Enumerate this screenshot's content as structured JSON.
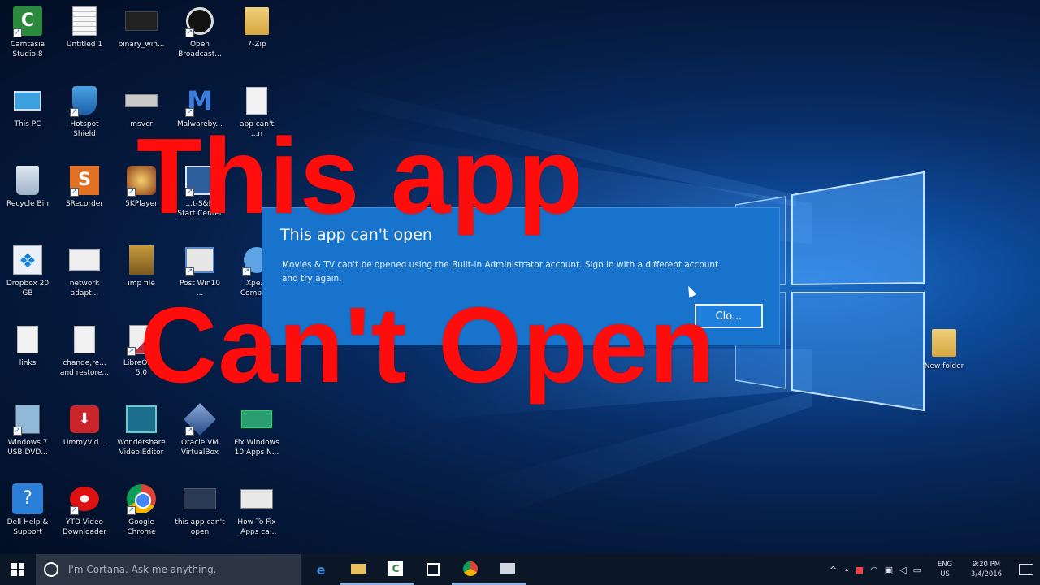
{
  "desktop": {
    "icons": [
      {
        "label": "Camtasia\nStudio 8",
        "icon": "camtasia-icon"
      },
      {
        "label": "Untitled 1",
        "icon": "document-icon"
      },
      {
        "label": "binary_win...",
        "icon": "video-thumbnail-icon"
      },
      {
        "label": "Open\nBroadcast...",
        "icon": "obs-icon"
      },
      {
        "label": "7-Zip",
        "icon": "folder-icon"
      },
      {
        "label": "This PC",
        "icon": "computer-icon"
      },
      {
        "label": "Hotspot\nShield",
        "icon": "shield-icon"
      },
      {
        "label": "msvcr",
        "icon": "file-icon"
      },
      {
        "label": "Malwareby...",
        "icon": "malwarebytes-icon"
      },
      {
        "label": "app can't\n...n",
        "icon": "document-icon"
      },
      {
        "label": "Recycle Bin",
        "icon": "recycle-bin-icon"
      },
      {
        "label": "SRecorder",
        "icon": "recorder-icon"
      },
      {
        "label": "5KPlayer",
        "icon": "player-icon"
      },
      {
        "label": "...t-S&D\nStart Center",
        "icon": "app-icon"
      },
      {
        "label": "Dropbox 20\nGB",
        "icon": "dropbox-icon"
      },
      {
        "label": "network\nadapt...",
        "icon": "network-icon"
      },
      {
        "label": "imp file",
        "icon": "archive-icon"
      },
      {
        "label": "Post Win10\n...",
        "icon": "app-icon"
      },
      {
        "label": "Xpe...\nCompa...",
        "icon": "app-icon"
      },
      {
        "label": "links",
        "icon": "document-icon"
      },
      {
        "label": "change,re...\nand restore...",
        "icon": "document-icon"
      },
      {
        "label": "LibreOff...\n5.0",
        "icon": "libreoffice-icon"
      },
      {
        "label": "Windows 7\nUSB DVD...",
        "icon": "usb-tool-icon"
      },
      {
        "label": "UmmyVid...",
        "icon": "ummy-icon"
      },
      {
        "label": "Wondershare\nVideo Editor",
        "icon": "video-editor-icon"
      },
      {
        "label": "Oracle VM\nVirtualBox",
        "icon": "virtualbox-icon"
      },
      {
        "label": "Fix Windows\n10 Apps N...",
        "icon": "video-thumbnail-icon"
      },
      {
        "label": "Dell Help &\nSupport",
        "icon": "dell-help-icon"
      },
      {
        "label": "YTD Video\nDownloader",
        "icon": "ytd-icon"
      },
      {
        "label": "Google\nChrome",
        "icon": "chrome-icon"
      },
      {
        "label": "this app can't\nopen",
        "icon": "video-thumbnail-icon"
      },
      {
        "label": "How To Fix\n_Apps ca...",
        "icon": "video-thumbnail-icon"
      },
      {
        "label": "New folder",
        "icon": "folder-icon"
      }
    ]
  },
  "dialog": {
    "title": "This app can't open",
    "message": "Movies & TV can't be opened using the Built-in Administrator account. Sign in with a different account and try again.",
    "button_label": "Clo..."
  },
  "overlay": {
    "line1": "This app",
    "line2": "Can't Open",
    "color": "#ff0d0d"
  },
  "taskbar": {
    "search_placeholder": "I'm Cortana. Ask me anything.",
    "apps": [
      "edge-icon",
      "file-explorer-icon",
      "camtasia-icon",
      "store-icon",
      "chrome-icon",
      "app-icon"
    ],
    "language_line1": "ENG",
    "language_line2": "US",
    "time": "9:20 PM",
    "date": "3/4/2016"
  }
}
